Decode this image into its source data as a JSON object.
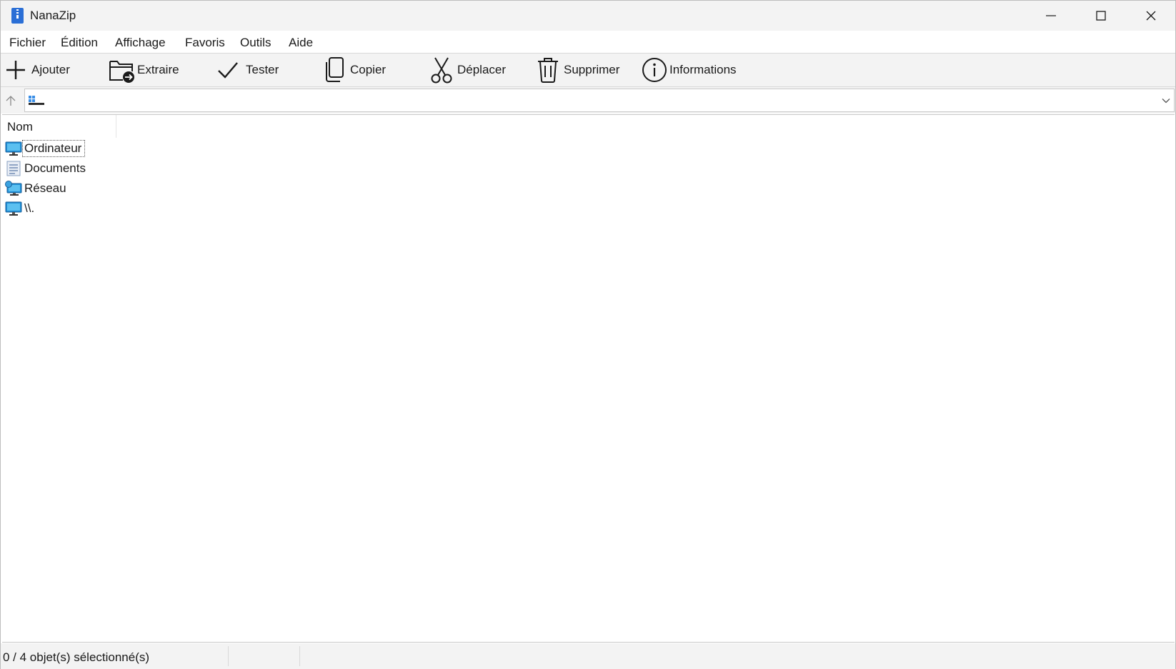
{
  "window": {
    "title": "NanaZip",
    "controls": [
      "minimize-icon",
      "maximize-icon",
      "close-icon"
    ]
  },
  "menu": {
    "items": [
      "Fichier",
      "Édition",
      "Affichage",
      "Favoris",
      "Outils",
      "Aide"
    ]
  },
  "toolbar": {
    "buttons": [
      {
        "label": "Ajouter",
        "icon": "add-icon"
      },
      {
        "label": "Extraire",
        "icon": "extract-icon"
      },
      {
        "label": "Tester",
        "icon": "checkmark-icon"
      },
      {
        "label": "Copier",
        "icon": "copy-icon"
      },
      {
        "label": "Déplacer",
        "icon": "scissors-icon"
      },
      {
        "label": "Supprimer",
        "icon": "trash-icon"
      },
      {
        "label": "Informations",
        "icon": "info-icon"
      }
    ]
  },
  "address": {
    "value": "",
    "icon": "computer-root-icon"
  },
  "filelist": {
    "columns": [
      "Nom"
    ],
    "rows": [
      {
        "name": "Ordinateur",
        "icon": "computer-icon",
        "focused": true
      },
      {
        "name": "Documents",
        "icon": "documents-icon",
        "focused": false
      },
      {
        "name": "Réseau",
        "icon": "network-icon",
        "focused": false
      },
      {
        "name": "\\\\.",
        "icon": "computer-icon",
        "focused": false
      }
    ]
  },
  "status": {
    "selection": "0 / 4 objet(s) sélectionné(s)",
    "panel2": "",
    "panel3": ""
  },
  "colors": {
    "chrome": "#f3f3f3",
    "icon_blue": "#1f8fd6",
    "text": "#1a1a1a"
  }
}
